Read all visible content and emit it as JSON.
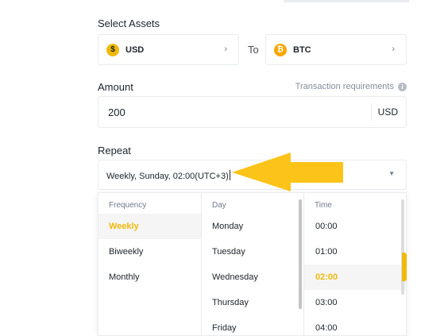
{
  "select_assets": {
    "label": "Select Assets",
    "from": {
      "code": "USD",
      "icon": "usd-coin-icon",
      "symbol": "$"
    },
    "connector": "To",
    "to": {
      "code": "BTC",
      "icon": "btc-coin-icon",
      "symbol": "₿"
    }
  },
  "amount": {
    "label": "Amount",
    "requirements_link": "Transaction requirements",
    "value": "200",
    "unit": "USD"
  },
  "repeat": {
    "label": "Repeat",
    "value": "Weekly, Sunday, 02:00(UTC+3)"
  },
  "dropdown": {
    "frequency": {
      "header": "Frequency",
      "options": [
        "Weekly",
        "Biweekly",
        "Monthly"
      ],
      "selected": "Weekly"
    },
    "day": {
      "header": "Day",
      "options": [
        "Monday",
        "Tuesday",
        "Wednesday",
        "Thursday",
        "Friday"
      ]
    },
    "time": {
      "header": "Time",
      "options": [
        "00:00",
        "01:00",
        "02:00",
        "03:00",
        "04:00"
      ],
      "selected": "02:00"
    }
  },
  "colors": {
    "accent": "#f0b90b",
    "annotation_arrow": "#fcc419",
    "border": "#eaecef"
  }
}
